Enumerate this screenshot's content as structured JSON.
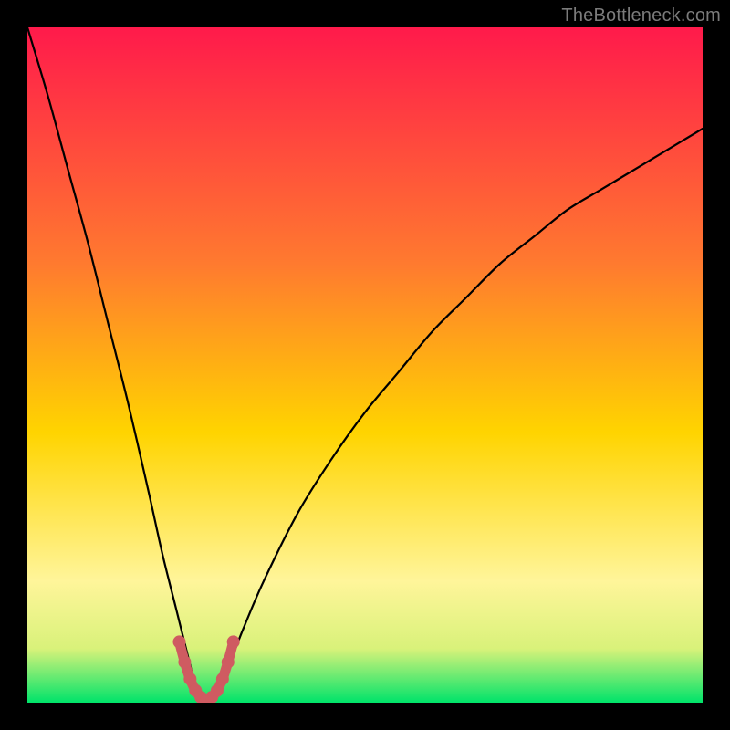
{
  "watermark": "TheBottleneck.com",
  "colors": {
    "frame": "#000000",
    "gradient_top": "#ff1a4b",
    "gradient_mid1": "#ff7a2f",
    "gradient_mid2": "#ffd400",
    "gradient_mid3": "#fff59a",
    "gradient_band": "#d9f27a",
    "gradient_bottom": "#00e36a",
    "curve": "#000000",
    "marker": "#cf5b61"
  },
  "chart_data": {
    "type": "line",
    "title": "",
    "xlabel": "",
    "ylabel": "",
    "xlim": [
      0,
      100
    ],
    "ylim": [
      0,
      100
    ],
    "note": "V-shaped bottleneck curve. Minimum (≈0) occurs near x≈25–28. Curve rises steeply toward 100 at x→0 and more gradually toward ~85 at x→100. Values estimated from pixel positions; no axis ticks or numeric labels are shown.",
    "series": [
      {
        "name": "bottleneck-curve",
        "x": [
          0,
          3,
          6,
          9,
          12,
          15,
          18,
          20,
          22,
          24,
          25,
          26,
          27,
          28,
          30,
          32,
          35,
          40,
          45,
          50,
          55,
          60,
          65,
          70,
          75,
          80,
          85,
          90,
          95,
          100
        ],
        "values": [
          100,
          90,
          79,
          68,
          56,
          44,
          31,
          22,
          14,
          6,
          2,
          0,
          0,
          2,
          6,
          11,
          18,
          28,
          36,
          43,
          49,
          55,
          60,
          65,
          69,
          73,
          76,
          79,
          82,
          85
        ]
      }
    ],
    "markers": {
      "name": "highlighted-minimum",
      "x": [
        22.5,
        23.3,
        24.1,
        24.9,
        25.7,
        26.5,
        27.3,
        28.1,
        28.9,
        29.7,
        30.5
      ],
      "values": [
        9,
        6,
        3.5,
        1.8,
        0.8,
        0.3,
        0.8,
        1.8,
        3.5,
        6,
        9
      ]
    }
  }
}
